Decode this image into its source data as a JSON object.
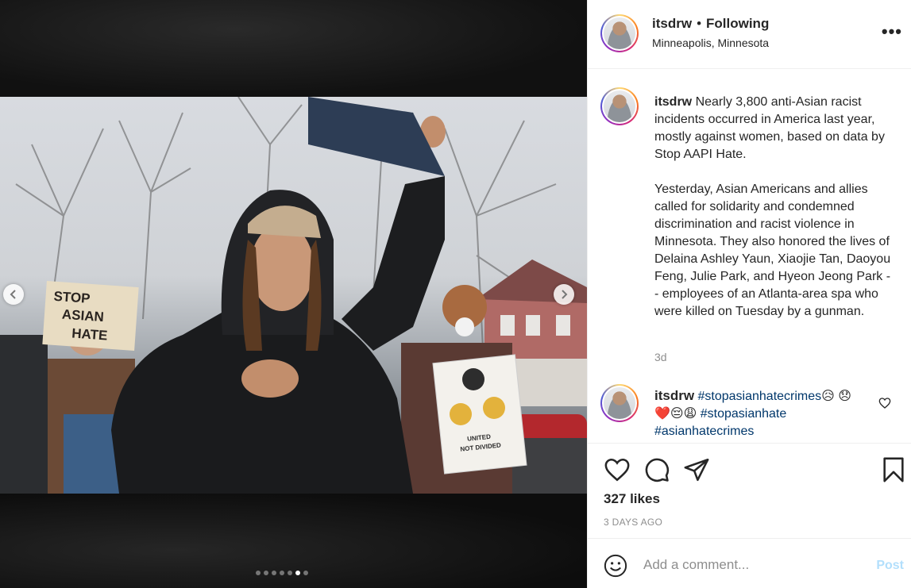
{
  "post": {
    "username": "itsdrw",
    "follow_status": "Following",
    "separator": "•",
    "location": "Minneapolis, Minnesota",
    "more_label": "•••"
  },
  "caption": {
    "username": "itsdrw",
    "text": "Nearly 3,800 anti-Asian racist incidents occurred in America last year, mostly against women, based on data by Stop AAPI Hate.\n\nYesterday, Asian Americans and allies called for solidarity and condemned discrimination and racist violence in Minnesota. They also honored the lives of Delaina Ashley Yaun, Xiaojie Tan, Daoyou Feng, Julie Park, and Hyeon Jeong Park -- employees of an Atlanta-area spa who were killed on Tuesday by a gunman.",
    "age": "3d"
  },
  "comment": {
    "username": "itsdrw",
    "hashtag1": "#stopasianhatecrimes",
    "emoji1": "😥",
    "emojis_line": "😞❤️😔😩",
    "hashtag2": "#stopasianhate",
    "hashtag3": "#asianhatecrimes"
  },
  "engagement": {
    "likes": "327 likes",
    "posted": "3 DAYS AGO"
  },
  "add_comment": {
    "placeholder": "Add a comment...",
    "post_label": "Post"
  },
  "photo_signs": {
    "left_sign": [
      "STOP",
      "ASIAN",
      "HATE"
    ],
    "right_sign": [
      "UNITED",
      "NOT DIVIDED"
    ]
  },
  "carousel": {
    "total": 7,
    "active_index": 5
  },
  "icons": {
    "like": "heart-icon",
    "comment": "comment-icon",
    "share": "share-icon",
    "save": "bookmark-icon",
    "emoji": "emoji-icon",
    "next": "chevron-right-icon",
    "prev": "chevron-left-icon"
  },
  "colors": {
    "hashtag": "#00376b",
    "post_button_disabled": "#b2dffc",
    "muted": "#8e8e8e"
  }
}
